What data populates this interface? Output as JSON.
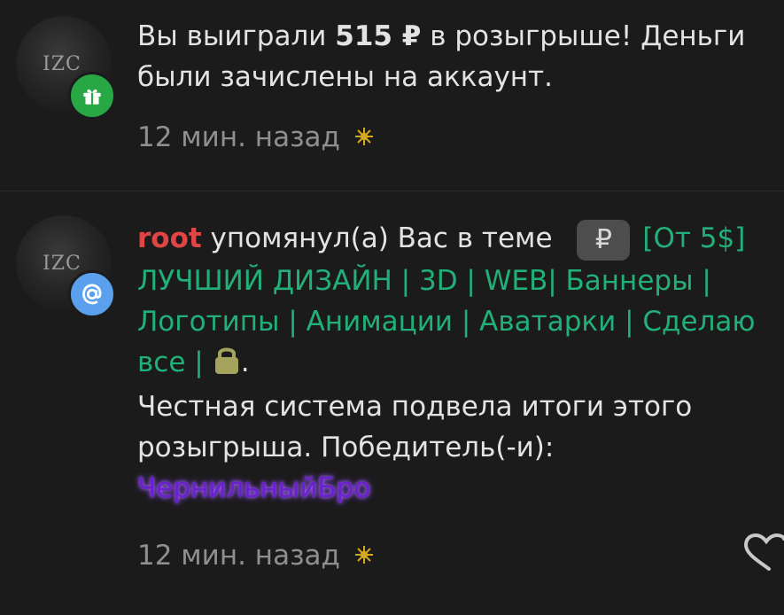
{
  "notifications": [
    {
      "avatar_icon": "server-logo",
      "badge_icon": "gift-icon",
      "badge_color": "#27a845",
      "text_before": "Вы выиграли ",
      "amount": "515 ₽",
      "text_after": " в розыгрыше! Деньги были зачислены на аккаунт.",
      "time": "12 мин. назад",
      "time_icon": "sparkle-icon"
    },
    {
      "avatar_icon": "server-logo",
      "badge_icon": "at-sign-icon",
      "badge_color": "#5aa0ec",
      "username": "root",
      "action": " упомянул(а) Вас в теме ",
      "prefix_symbol": "₽",
      "thread_title": "[От 5$] ЛУЧШИЙ ДИЗАЙН | 3D | WEB| Баннеры | Логотипы | Анимации | Аватарки | Сделаю все |",
      "thread_suffix": ".",
      "message": "Честная система подвела итоги этого розыгрыша. Победитель(-и):",
      "winner": "ЧернильныйБро",
      "time": "12 мин. назад",
      "time_icon": "sparkle-icon",
      "like_icon": "heart-icon"
    }
  ],
  "colors": {
    "background": "#1b1b1b",
    "username": "#e04545",
    "thread_link": "#22b07a",
    "winner": "#6a1fd0",
    "lock": "#a5a45c"
  }
}
